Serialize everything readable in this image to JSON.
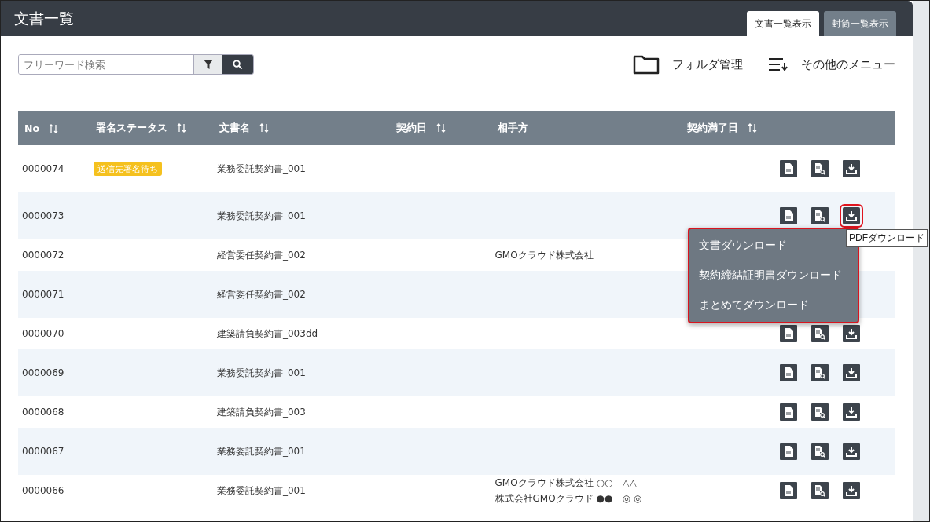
{
  "title": "文書一覧",
  "tabs": [
    {
      "label": "文書一覧表示",
      "selected": true
    },
    {
      "label": "封筒一覧表示",
      "selected": false
    }
  ],
  "search": {
    "placeholder": "フリーワード検索"
  },
  "toolbar": [
    {
      "kind": "folder",
      "label": "フォルダ管理"
    },
    {
      "kind": "menu",
      "label": "その他のメニュー"
    }
  ],
  "table": {
    "columns": [
      {
        "label": "No",
        "sortable": true
      },
      {
        "label": "署名ステータス",
        "sortable": true
      },
      {
        "label": "文書名",
        "sortable": true
      },
      {
        "label": "契約日",
        "sortable": true
      },
      {
        "label": "相手方",
        "sortable": false
      },
      {
        "label": "契約満了日",
        "sortable": true
      }
    ],
    "rows": [
      {
        "no": "0000074",
        "status": "送信先署名待ち",
        "name": "業務委託契約書_001",
        "download_focused": false
      },
      {
        "no": "0000073",
        "name": "業務委託契約書_001",
        "download_focused": true
      },
      {
        "no": "0000072",
        "name": "経営委任契約書_002",
        "partner": [
          "GMOクラウド株式会社"
        ],
        "actions_visible": false
      },
      {
        "no": "0000071",
        "name": "経営委任契約書_002",
        "actions_visible": false
      },
      {
        "no": "0000070",
        "name": "建築請負契約書_003dd",
        "download_focused": false
      },
      {
        "no": "0000069",
        "name": "業務委託契約書_001",
        "download_focused": false
      },
      {
        "no": "0000068",
        "name": "建築請負契約書_003",
        "download_focused": false
      },
      {
        "no": "0000067",
        "name": "業務委託契約書_001",
        "download_focused": false
      },
      {
        "no": "0000066",
        "name": "業務委託契約書_001",
        "partner": [
          "GMOクラウド株式会社 ○○　△△",
          "株式会社GMOクラウド ●●　◎ ◎"
        ],
        "download_focused": false
      }
    ]
  },
  "download_menu": {
    "items": [
      "文書ダウンロード",
      "契約締結証明書ダウンロード",
      "まとめてダウンロード"
    ],
    "tooltip": "PDFダウンロード"
  }
}
